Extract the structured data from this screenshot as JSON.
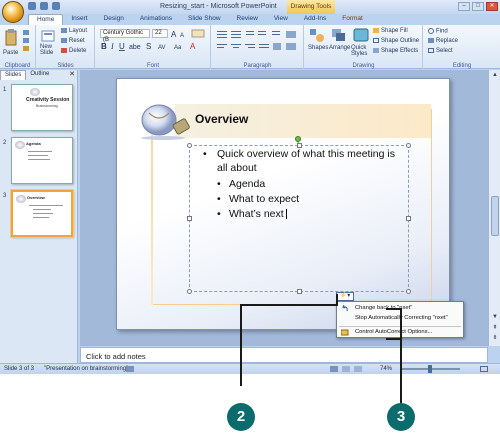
{
  "app": {
    "window_title": "Resizing_start - Microsoft PowerPoint",
    "context_tab_group": "Drawing Tools",
    "window_buttons": [
      "–",
      "□",
      "✕"
    ]
  },
  "ribbon_tabs": [
    "Home",
    "Insert",
    "Design",
    "Animations",
    "Slide Show",
    "Review",
    "View",
    "Add-Ins",
    "Format"
  ],
  "ribbon": {
    "clipboard": {
      "label": "Clipboard",
      "paste": "Paste"
    },
    "slides": {
      "label": "Slides",
      "new_slide": "New Slide",
      "layout": "Layout",
      "reset": "Reset",
      "delete": "Delete"
    },
    "font": {
      "label": "Font",
      "font_name": "Century Gothic (B",
      "font_size": "22"
    },
    "paragraph": {
      "label": "Paragraph"
    },
    "drawing": {
      "label": "Drawing",
      "shapes": "Shapes",
      "arrange": "Arrange",
      "quick_styles": "Quick Styles",
      "shape_fill": "Shape Fill",
      "shape_outline": "Shape Outline",
      "shape_effects": "Shape Effects"
    },
    "editing": {
      "label": "Editing",
      "find": "Find",
      "replace": "Replace",
      "select": "Select"
    }
  },
  "slide_pane": {
    "tabs": [
      "Slides",
      "Outline"
    ],
    "close": "✕",
    "thumbnails": [
      {
        "number": "1",
        "title": "Creativity Session",
        "subtitle": "Brainstorming"
      },
      {
        "number": "2",
        "title": "Agenda"
      },
      {
        "number": "3",
        "title": "Overview"
      }
    ]
  },
  "slide": {
    "title": "Overview",
    "bullet_main": "Quick overview of what this meeting is all about",
    "sub_bullets": [
      "Agenda",
      "What to expect",
      "What’s next"
    ],
    "bullet_glyph": "•"
  },
  "autocorrect": {
    "button_label": "⚡▾",
    "items": [
      "Change back to \"nxet\"",
      "Stop Automatically Correcting \"nxet\"",
      "Control AutoCorrect Options..."
    ]
  },
  "notes": {
    "placeholder": "Click to add notes"
  },
  "status_bar": {
    "slide_info": "Slide 3 of 3",
    "theme": "\"Presentation on brainstorming\"",
    "zoom": "74%"
  },
  "callouts": [
    "2",
    "3"
  ],
  "colors": {
    "callout": "#0c6b6d",
    "accent_selection": "#f3a33b"
  }
}
